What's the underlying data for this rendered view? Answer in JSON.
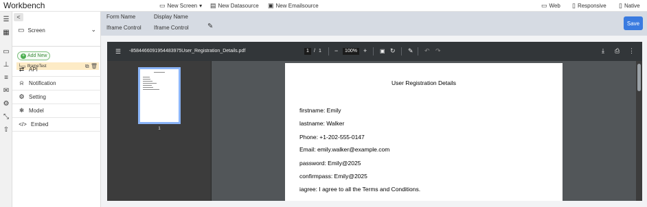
{
  "app": {
    "title": "Workbench"
  },
  "topbar": {
    "new_screen": "New Screen",
    "new_datasource": "New Datasource",
    "new_emailsource": "New Emailsource",
    "web": "Web",
    "responsive": "Responsive",
    "native": "Native"
  },
  "sidebar": {
    "collapse_glyph": "<",
    "screen_select": "Screen",
    "add_new": "Add New",
    "tree_item": "IframeTest",
    "menu": [
      {
        "label": "API",
        "icon": "arrows-exchange-icon",
        "glyph": "⇄"
      },
      {
        "label": "Notification",
        "icon": "bell-icon",
        "glyph": "🔔"
      },
      {
        "label": "Setting",
        "icon": "gear-icon",
        "glyph": "⚙"
      },
      {
        "label": "Model",
        "icon": "snowflake-icon",
        "glyph": "❄"
      },
      {
        "label": "Embed",
        "icon": "code-icon",
        "glyph": "</>"
      }
    ]
  },
  "formbar": {
    "form_name_label": "Form Name",
    "display_name_label": "Display Name",
    "form_name_value": "Iframe Control",
    "display_name_value": "Iframe Control",
    "save_label": "Save"
  },
  "pdf": {
    "filename": "-8584466091954483975User_Registration_Details.pdf",
    "page_current": "1",
    "page_separator": "/",
    "page_total": "1",
    "zoom": "100%",
    "thumb_page_number": "1",
    "doc_title": "User Registration Details",
    "lines": [
      "firstname: Emily",
      "lastname: Walker",
      "Phone: +1-202-555-0147",
      "Email: emily.walker@example.com",
      "password: Emily@2025",
      "confirmpass: Emily@2025",
      "iagree: I agree to all the Terms and Conditions."
    ]
  },
  "colors": {
    "accent": "#3a7be0",
    "formbar_bg": "#d6dbe3",
    "pdf_toolbar": "#323639",
    "pdf_bg": "#525659",
    "tree_highlight": "#fdebc6"
  }
}
